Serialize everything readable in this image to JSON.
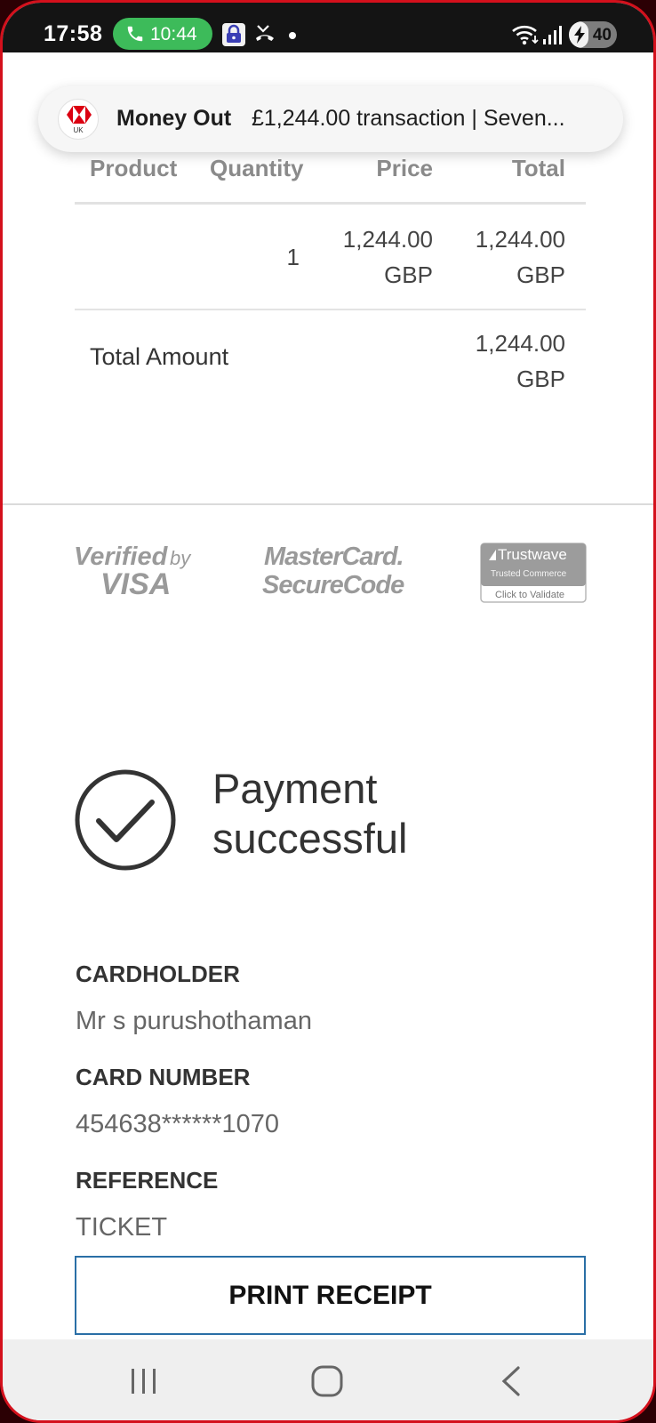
{
  "status_bar": {
    "time": "17:58",
    "call_timer": "10:44",
    "battery_level": "40",
    "battery_fraction": 0.4,
    "icons": [
      "phone-icon",
      "vpn-lock-icon",
      "missed-call-icon",
      "notification-dot-icon",
      "wifi-icon",
      "signal-icon",
      "battery-charging-icon"
    ]
  },
  "notification": {
    "app_logo": "hsbc-logo",
    "logo_sub": "UK",
    "title": "Money Out",
    "body": "£1,244.00 transaction | Seven..."
  },
  "table": {
    "headers": {
      "product": "Product",
      "quantity": "Quantity",
      "price": "Price",
      "total": "Total"
    },
    "rows": [
      {
        "product": "",
        "quantity": "1",
        "price_line1": "1,244.00",
        "price_line2": "GBP",
        "total_line1": "1,244.00",
        "total_line2": "GBP"
      }
    ],
    "total_label": "Total Amount",
    "total_line1": "1,244.00",
    "total_line2": "GBP"
  },
  "badges": {
    "visa_line1": "Verified",
    "visa_by": "by",
    "visa_line2": "VISA",
    "mc_line1": "MasterCard.",
    "mc_line2": "SecureCode",
    "trustwave_name": "Trustwave",
    "trustwave_sub": "Trusted Commerce",
    "trustwave_cta": "Click to Validate"
  },
  "payment": {
    "status_line1": "Payment",
    "status_line2": "successful",
    "cardholder_label": "CARDHOLDER",
    "cardholder_value": "Mr s purushothaman",
    "card_number_label": "CARD NUMBER",
    "card_number_value": "454638******1070",
    "reference_label": "REFERENCE",
    "reference_value": "TICKET",
    "print_button": "PRINT RECEIPT"
  },
  "nav_bar": {
    "icons": [
      "recents-icon",
      "home-icon",
      "back-icon"
    ]
  },
  "colors": {
    "accent_red": "#d4101c",
    "call_green": "#3dbb5a",
    "button_border": "#2a6fa6",
    "text_dark": "#333333",
    "text_muted": "#8a8a8a"
  }
}
